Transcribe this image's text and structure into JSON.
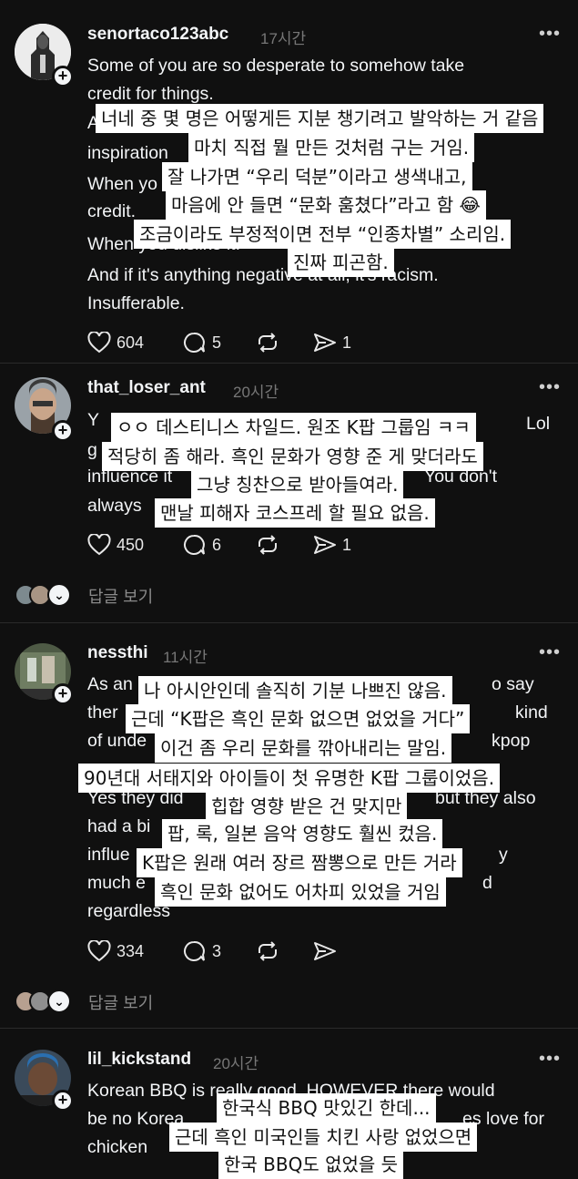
{
  "posts": [
    {
      "username": "senortaco123abc",
      "time": "17시간",
      "lines": [
        "Some of you are so desperate to somehow take",
        "credit for things.",
        "A",
        "inspiration",
        "When yo",
        "credit.",
        "When you dislike it.",
        "And if it's anything negative at all, it's racism.",
        "Insufferable."
      ],
      "likes": "604",
      "comments": "5",
      "shares": "1",
      "subs": [
        "너네 중 몇 명은 어떻게든 지분 챙기려고 발악하는 거 같음",
        "마치 직접 뭘 만든 것처럼 구는 거임.",
        "잘 나가면 “우리 덕분”이라고 생색내고,",
        "마음에 안 들면 “문화 훔쳤다”라고 함 😂",
        "조금이라도 부정적이면 전부 “인종차별” 소리임.",
        "진짜 피곤함."
      ]
    },
    {
      "username": "that_loser_ant",
      "time": "20시간",
      "lines": [
        "Y",
        "Lol",
        "g",
        "influence it",
        "You don't",
        "always"
      ],
      "likes": "450",
      "comments": "6",
      "shares": "1",
      "replies_label": "답글 보기",
      "subs": [
        "ㅇㅇ 데스티니스 차일드. 원조 K팝 그룹임 ㅋㅋ",
        "적당히 좀 해라. 흑인 문화가 영향 준 게 맞더라도",
        "그냥 칭찬으로 받아들여라.",
        "맨날 피해자 코스프레 할 필요 없음."
      ]
    },
    {
      "username": "nessthi",
      "time": "11시간",
      "lines": [
        "As an",
        "o say",
        "ther",
        "kind",
        "of unde",
        "kpop",
        "Yes they did",
        "but they also",
        "had a bi",
        "influe",
        "y",
        "much e",
        "d",
        "regardless"
      ],
      "likes": "334",
      "comments": "3",
      "replies_label": "답글 보기",
      "subs": [
        "나 아시안인데 솔직히 기분 나쁘진 않음.",
        "근데 “K팝은 흑인 문화 없으면 없었을 거다”",
        "이건 좀 우리 문화를 깎아내리는 말임.",
        "90년대 서태지와 아이들이 첫 유명한 K팝 그룹이었음.",
        "힙합 영향 받은 건 맞지만",
        "팝, 록, 일본 음악 영향도 훨씬 컸음.",
        "K팝은 원래 여러 장르 짬뽕으로 만든 거라",
        "흑인 문화 없어도 어차피 있었을 거임"
      ]
    },
    {
      "username": "lil_kickstand",
      "time": "20시간",
      "lines": [
        "Korean BBQ is really good. HOWEVER there would",
        "be no Korea",
        "es love for",
        "chicken"
      ],
      "subs": [
        "한국식 BBQ 맛있긴 한데...",
        "근데 흑인 미국인들 치킨 사랑 없었으면",
        "한국 BBQ도 없었을 듯"
      ]
    }
  ],
  "colors": {
    "background": "#101010",
    "text": "#f3f5f7",
    "muted": "#777777",
    "subtitle_bg": "#ffffff"
  }
}
